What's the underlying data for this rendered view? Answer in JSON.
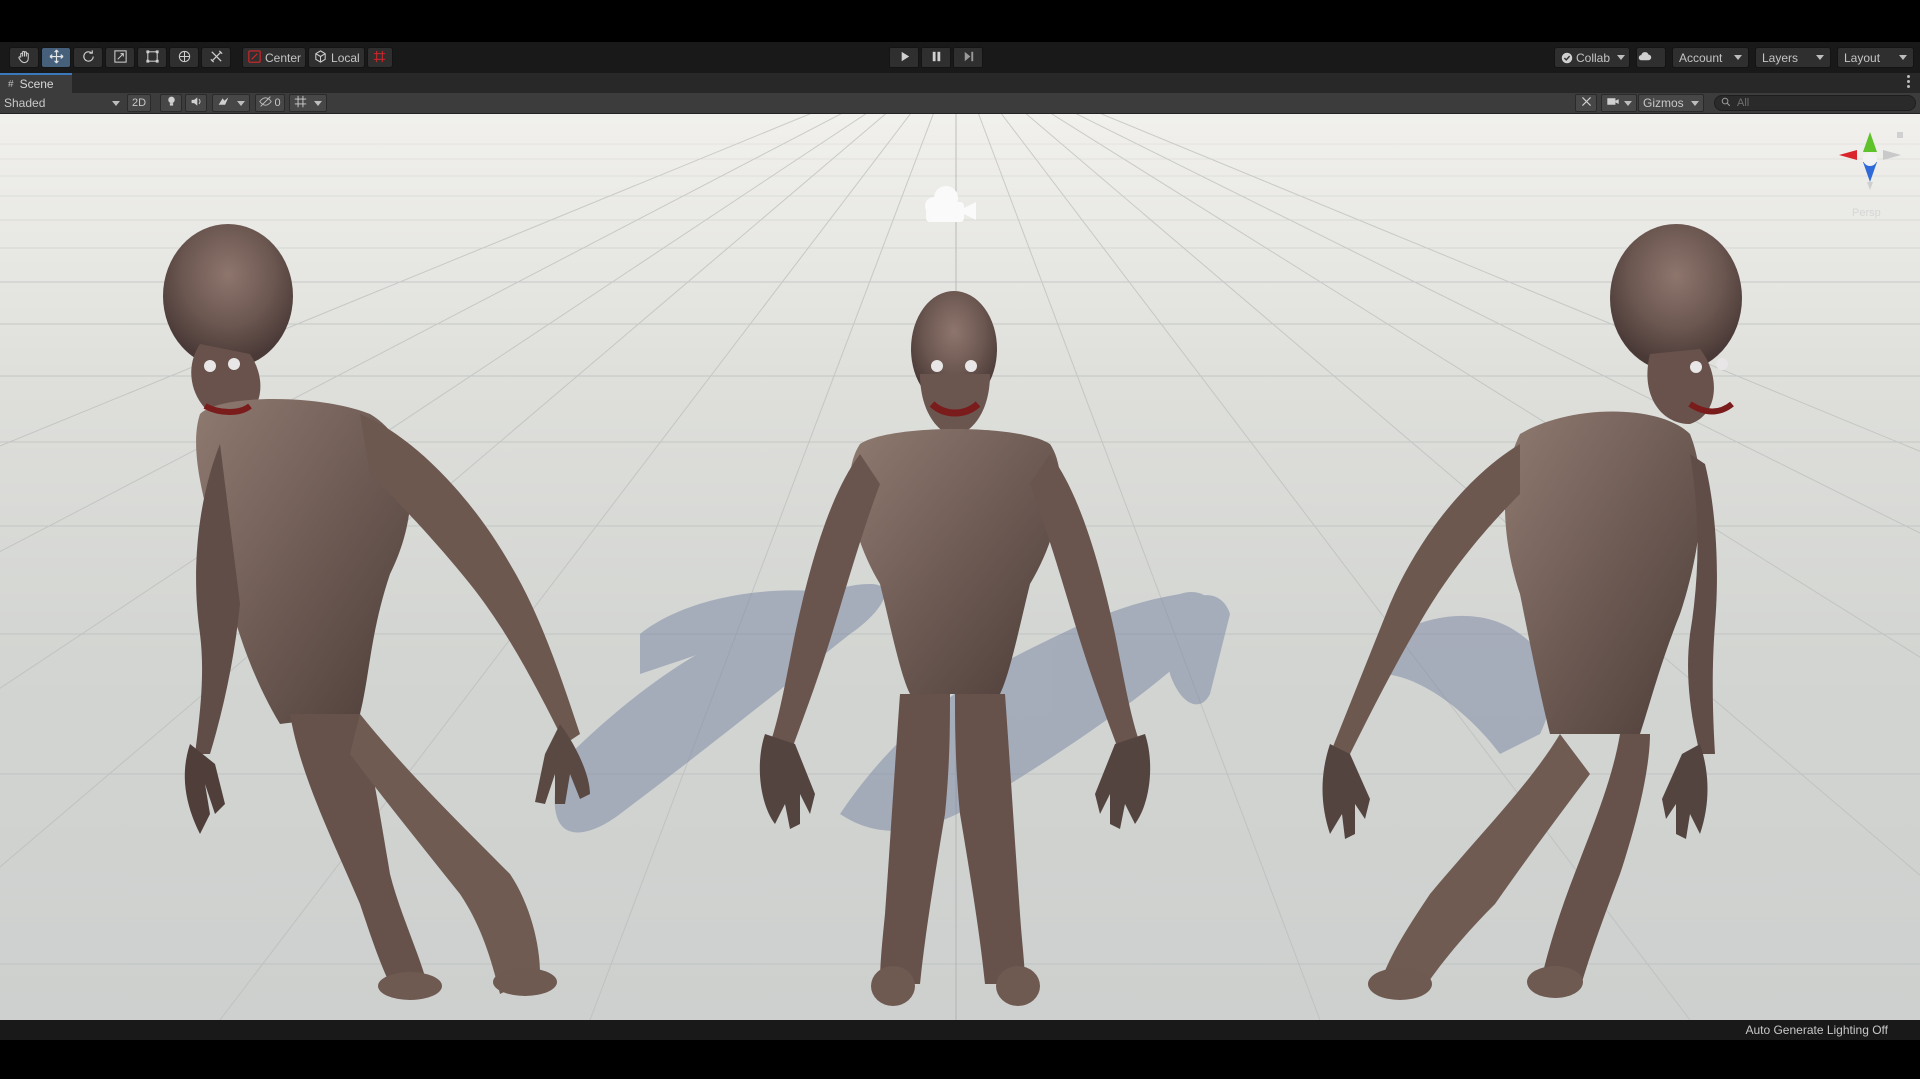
{
  "toolbar": {
    "center_label": "Center",
    "local_label": "Local",
    "collab_label": "Collab",
    "account_label": "Account",
    "layers_label": "Layers",
    "layout_label": "Layout"
  },
  "scene_tab": {
    "title": "Scene"
  },
  "scene_toolbar": {
    "shading_mode": "Shaded",
    "mode_2d": "2D",
    "hidden_count": "0",
    "gizmos_label": "Gizmos",
    "search_placeholder": "All"
  },
  "viewport": {
    "projection_label": "Persp",
    "objects": [
      "zombie-left",
      "zombie-center",
      "zombie-right"
    ]
  },
  "status_bar": {
    "lighting_status": "Auto Generate Lighting Off"
  },
  "colors": {
    "toolbar_bg": "#191919",
    "panel_bg": "#3c3c3c",
    "active_tool": "#46607c",
    "axis_x": "#d9262b",
    "axis_y": "#5ec22b",
    "axis_z": "#2f6ad8",
    "sky": "#f1f0ec",
    "ground": "#cdd0ce"
  }
}
